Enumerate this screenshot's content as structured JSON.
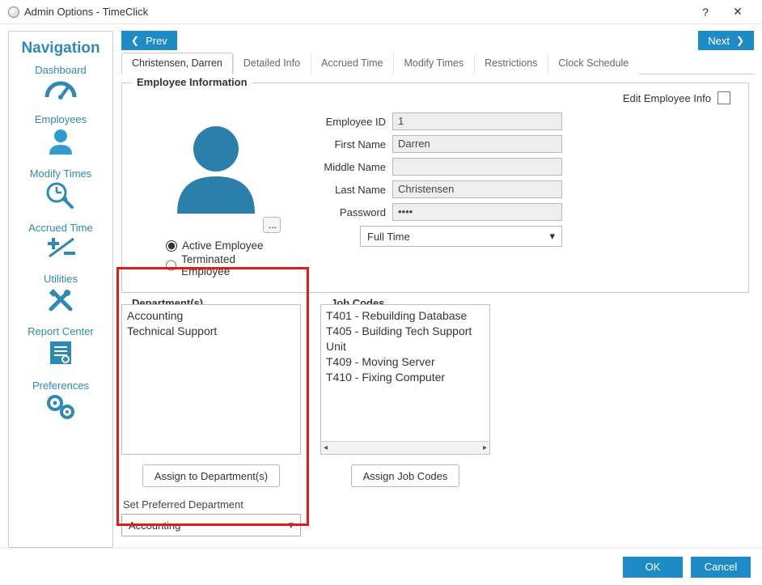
{
  "window": {
    "title": "Admin Options - TimeClick",
    "help": "?",
    "close": "✕"
  },
  "sidebar": {
    "title": "Navigation",
    "items": [
      {
        "label": "Dashboard"
      },
      {
        "label": "Employees"
      },
      {
        "label": "Modify Times"
      },
      {
        "label": "Accrued Time"
      },
      {
        "label": "Utilities"
      },
      {
        "label": "Report Center"
      },
      {
        "label": "Preferences"
      }
    ]
  },
  "nav": {
    "prev": "Prev",
    "next": "Next"
  },
  "tabs": [
    "Christensen, Darren",
    "Detailed Info",
    "Accrued Time",
    "Modify Times",
    "Restrictions",
    "Clock Schedule"
  ],
  "empInfo": {
    "legend": "Employee Information",
    "edit_label": "Edit Employee Info",
    "photo_btn": "...",
    "radio_active": "Active Employee",
    "radio_terminated": "Terminated Employee",
    "fields": {
      "employee_id": {
        "label": "Employee ID",
        "value": "1"
      },
      "first_name": {
        "label": "First Name",
        "value": "Darren"
      },
      "middle_name": {
        "label": "Middle Name",
        "value": ""
      },
      "last_name": {
        "label": "Last Name",
        "value": "Christensen"
      },
      "password": {
        "label": "Password",
        "value": "••••"
      }
    },
    "type_dd": {
      "value": "Full Time"
    }
  },
  "departments": {
    "legend": "Department(s)",
    "items": [
      "Accounting",
      "Technical Support"
    ],
    "assign_btn": "Assign to Department(s)",
    "pref_label": "Set Preferred Department",
    "pref_value": "Accounting"
  },
  "jobcodes": {
    "legend": "Job Codes",
    "items": [
      "T401 - Rebuilding Database",
      "T405 - Building Tech Support Unit",
      "T409 - Moving Server",
      "T410 - Fixing Computer"
    ],
    "assign_btn": "Assign Job Codes"
  },
  "footer": {
    "ok": "OK",
    "cancel": "Cancel"
  }
}
